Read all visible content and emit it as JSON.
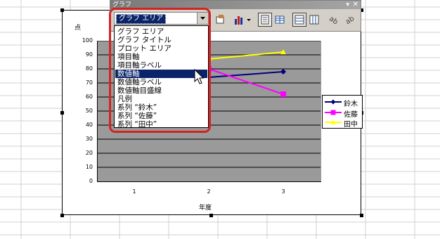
{
  "toolbar": {
    "title": "グラフ",
    "combo_value": "グラフ エリア",
    "dropdown_items": [
      "グラフ エリア",
      "グラフ タイトル",
      "プロット エリア",
      "項目軸",
      "項目軸ラベル",
      "数値軸",
      "数値軸ラベル",
      "数値軸目盛線",
      "凡例",
      "系列 “鈴木”",
      "系列 “佐藤”",
      "系列 “田中”"
    ],
    "selected_item": "数値軸",
    "icons": [
      "format-object-icon",
      "chart-type-icon",
      "legend-icon",
      "data-table-icon",
      "by-row-icon",
      "by-column-icon",
      "angle-text-down-icon",
      "angle-text-up-icon"
    ]
  },
  "chart": {
    "y_axis_title": "点",
    "x_axis_title": "年度"
  },
  "chart_data": {
    "type": "line",
    "categories": [
      "1",
      "2",
      "3"
    ],
    "yticks": [
      "100",
      "90",
      "80",
      "70",
      "60",
      "50",
      "40",
      "30",
      "20",
      "10",
      "0"
    ],
    "ylim": [
      0,
      100
    ],
    "grid": true,
    "legend_position": "right",
    "series": [
      {
        "name": "鈴木",
        "color": "#000080",
        "marker": "diamond",
        "values": [
          70,
          74,
          78
        ]
      },
      {
        "name": "佐藤",
        "color": "#ff00ff",
        "marker": "square",
        "values": [
          84,
          80,
          62
        ]
      },
      {
        "name": "田中",
        "color": "#ffff00",
        "marker": "triangle",
        "values": [
          83,
          87,
          92
        ]
      }
    ]
  }
}
